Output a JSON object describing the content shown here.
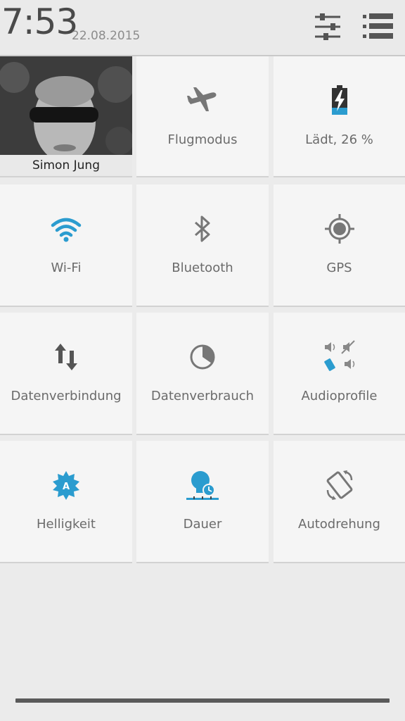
{
  "status": {
    "time": "7:53",
    "date": "22.08.2015"
  },
  "header": {
    "settings_icon": "sliders-icon",
    "list_icon": "list-icon"
  },
  "profile": {
    "name": "Simon Jung"
  },
  "tiles": [
    {
      "label": "Flugmodus",
      "icon": "airplane-icon",
      "active": false
    },
    {
      "label": "Lädt, 26 %",
      "icon": "battery-charging-icon",
      "active": true,
      "level": 26
    },
    {
      "label": "Wi-Fi",
      "icon": "wifi-icon",
      "active": true
    },
    {
      "label": "Bluetooth",
      "icon": "bluetooth-icon",
      "active": false
    },
    {
      "label": "GPS",
      "icon": "gps-icon",
      "active": false
    },
    {
      "label": "Datenverbindung",
      "icon": "data-arrows-icon",
      "active": false
    },
    {
      "label": "Datenverbrauch",
      "icon": "pie-icon",
      "active": false
    },
    {
      "label": "Audioprofile",
      "icon": "audio-profiles-icon",
      "active": true
    },
    {
      "label": "Helligkeit",
      "icon": "brightness-auto-icon",
      "active": true
    },
    {
      "label": "Dauer",
      "icon": "timeout-icon",
      "active": true
    },
    {
      "label": "Autodrehung",
      "icon": "rotate-icon",
      "active": false
    }
  ],
  "colors": {
    "accent": "#2b9ccf",
    "icon_inactive": "#777777",
    "tile_bg": "#f5f5f5",
    "panel_bg": "#ebebeb"
  }
}
